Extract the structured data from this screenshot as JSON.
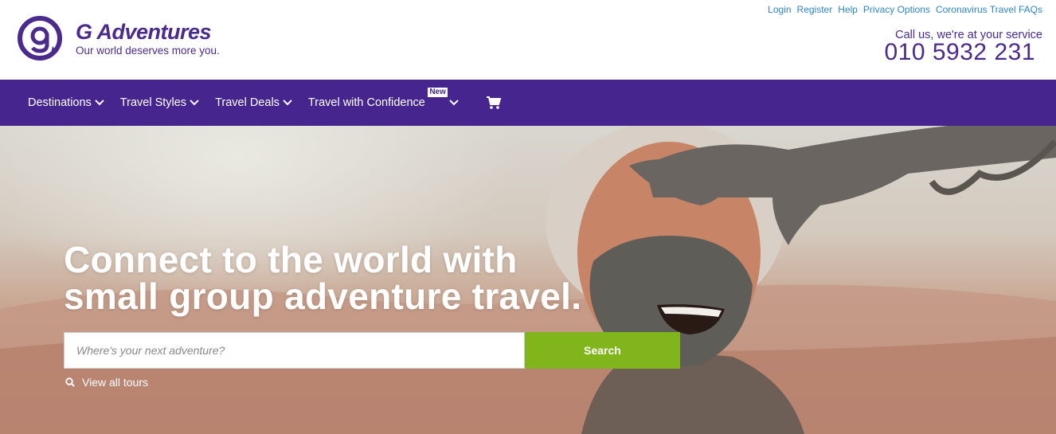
{
  "header": {
    "logo_name": "G Adventures",
    "logo_tagline": "Our world deserves more you.",
    "top_links": [
      "Login",
      "Register",
      "Help",
      "Privacy Options",
      "Coronavirus Travel FAQs"
    ],
    "callus": "Call us, we're at your service",
    "phone": "010 5932 231"
  },
  "nav": {
    "items": [
      "Destinations",
      "Travel Styles",
      "Travel Deals",
      "Travel with Confidence"
    ],
    "new_badge": "New",
    "cart_icon": "cart-icon"
  },
  "hero": {
    "headline_line1": "Connect to the world with",
    "headline_line2": "small group adventure travel.",
    "search_placeholder": "Where's your next adventure?",
    "search_button": "Search",
    "view_all": "View all tours"
  },
  "colors": {
    "brand_purple": "#46258f",
    "link_blue": "#2d86c8",
    "search_green": "#80b51c"
  }
}
